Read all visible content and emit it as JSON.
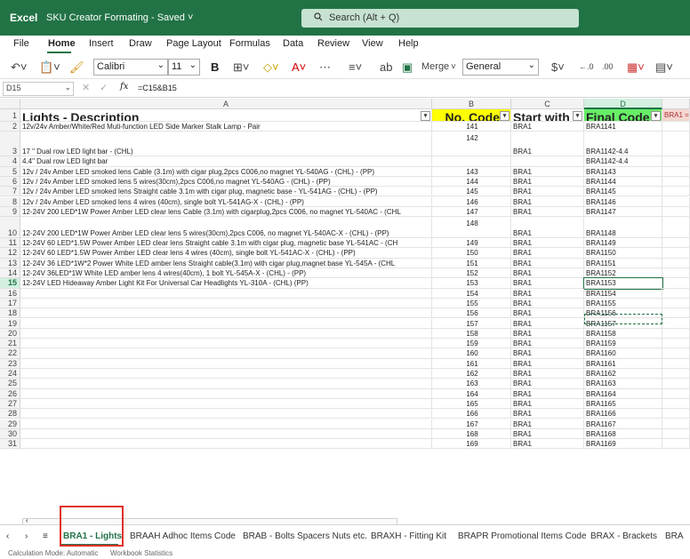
{
  "app": {
    "name": "Excel",
    "doc_title": "SKU Creator Formating",
    "saved_label": "-  Saved",
    "search_placeholder": "Search (Alt + Q)"
  },
  "menu": [
    "File",
    "Home",
    "Insert",
    "Draw",
    "Page Layout",
    "Formulas",
    "Data",
    "Review",
    "View",
    "Help"
  ],
  "ribbon": {
    "font_name": "Calibri",
    "font_size": "11",
    "bold": "B",
    "merge_label": "Merge",
    "number_format": "General",
    "currency_symbol": "$"
  },
  "formula_bar": {
    "cell_ref": "D15",
    "fx": "fx",
    "formula": "=C15&B15"
  },
  "columns": [
    {
      "letter": "A",
      "header": "Lights - Description",
      "selected": false
    },
    {
      "letter": "B",
      "header": "No. Code",
      "selected": false
    },
    {
      "letter": "C",
      "header": "Start with",
      "selected": false
    },
    {
      "letter": "D",
      "header": "Final Code",
      "selected": true
    }
  ],
  "overflow_cell": "BRA1 =",
  "header_colors": {
    "no_code": "#ffff00",
    "final_code": "#66ee66"
  },
  "rows": [
    {
      "n": "2",
      "a": "12v/24v Amber/White/Red Muti-function LED Side Marker Stalk Lamp - Pair",
      "b": "141",
      "c": "BRA1",
      "d": "BRA1141"
    },
    {
      "n": "3",
      "a": "17 \" Dual row LED light bar - (CHL)",
      "b": "142",
      "c": "BRA1",
      "d": "BRA1142-4.4"
    },
    {
      "n": "4",
      "a": "4.4\" Dual row LED light bar",
      "b": "",
      "c": "",
      "d": "BRA1142-4.4"
    },
    {
      "n": "5",
      "a": "12v / 24v  Amber LED smoked lens Cable (3.1m) with cigar plug,2pcs C006,no magnet YL-540AG - (CHL) - (PP)",
      "b": "143",
      "c": "BRA1",
      "d": "BRA1143"
    },
    {
      "n": "6",
      "a": "12v / 24v Amber LED smoked lens 5 wires(30cm),2pcs C006,no magnet YL-540AG - (CHL) - (PP)",
      "b": "144",
      "c": "BRA1",
      "d": "BRA1144"
    },
    {
      "n": "7",
      "a": "12v / 24v  Amber LED smoked lens Straight cable 3.1m with cigar plug, magnetic base - YL-541AG - (CHL)  - (PP)",
      "b": "145",
      "c": "BRA1",
      "d": "BRA1145"
    },
    {
      "n": "8",
      "a": "12v / 24v Amber LED smoked lens 4 wires (40cm), single bolt YL-541AG-X - (CHL) - (PP)",
      "b": "146",
      "c": "BRA1",
      "d": "BRA1146"
    },
    {
      "n": "9",
      "a": "12-24V 200 LED*1W Power Amber LED clear lens Cable (3.1m) with cigarplug,2pcs C006, no magnet YL-540AC - (CHL",
      "b": "147",
      "c": "BRA1",
      "d": "BRA1147"
    },
    {
      "n": "10",
      "a": "12-24V 200 LED*1W Power Amber LED clear lens 5 wires(30cm),2pcs C006, no magnet YL-540AC-X - (CHL) - (PP)",
      "b": "148",
      "c": "BRA1",
      "d": "BRA1148"
    },
    {
      "n": "11",
      "a": "12-24V 60 LED*1.5W Power Amber LED clear lens Straight cable 3.1m with cigar plug, magnetic base YL-541AC - (CH",
      "b": "149",
      "c": "BRA1",
      "d": "BRA1149"
    },
    {
      "n": "12",
      "a": "12-24V 60 LED*1.5W Power Amber LED clear lens 4 wires (40cm), single bolt YL-541AC-X - (CHL) - (PP)",
      "b": "150",
      "c": "BRA1",
      "d": "BRA1150"
    },
    {
      "n": "13",
      "a": "12-24V 36 LED*1W*2 Power White LED amber lens Straight cable(3.1m) with cigar plug,magnet base YL-545A - (CHL",
      "b": "151",
      "c": "BRA1",
      "d": "BRA1151"
    },
    {
      "n": "14",
      "a": "12-24V 36LED*1W White LED amber lens 4 wires(40cm), 1 bolt YL-545A-X - (CHL) - (PP)",
      "b": "152",
      "c": "BRA1",
      "d": "BRA1152"
    },
    {
      "n": "15",
      "a": "12-24V LED Hideaway Amber Light Kit For Universal Car Headlights YL-310A - (CHL) (PP)",
      "b": "153",
      "c": "BRA1",
      "d": "BRA1153"
    },
    {
      "n": "16",
      "a": "",
      "b": "154",
      "c": "BRA1",
      "d": "BRA1154"
    },
    {
      "n": "17",
      "a": "",
      "b": "155",
      "c": "BRA1",
      "d": "BRA1155"
    },
    {
      "n": "18",
      "a": "",
      "b": "156",
      "c": "BRA1",
      "d": "BRA1156"
    },
    {
      "n": "19",
      "a": "",
      "b": "157",
      "c": "BRA1",
      "d": "BRA1157"
    },
    {
      "n": "20",
      "a": "",
      "b": "158",
      "c": "BRA1",
      "d": "BRA1158"
    },
    {
      "n": "21",
      "a": "",
      "b": "159",
      "c": "BRA1",
      "d": "BRA1159"
    },
    {
      "n": "22",
      "a": "",
      "b": "160",
      "c": "BRA1",
      "d": "BRA1160"
    },
    {
      "n": "23",
      "a": "",
      "b": "161",
      "c": "BRA1",
      "d": "BRA1161"
    },
    {
      "n": "24",
      "a": "",
      "b": "162",
      "c": "BRA1",
      "d": "BRA1162"
    },
    {
      "n": "25",
      "a": "",
      "b": "163",
      "c": "BRA1",
      "d": "BRA1163"
    },
    {
      "n": "26",
      "a": "",
      "b": "164",
      "c": "BRA1",
      "d": "BRA1164"
    },
    {
      "n": "27",
      "a": "",
      "b": "165",
      "c": "BRA1",
      "d": "BRA1165"
    },
    {
      "n": "28",
      "a": "",
      "b": "166",
      "c": "BRA1",
      "d": "BRA1166"
    },
    {
      "n": "29",
      "a": "",
      "b": "167",
      "c": "BRA1",
      "d": "BRA1167"
    },
    {
      "n": "30",
      "a": "",
      "b": "168",
      "c": "BRA1",
      "d": "BRA1168"
    },
    {
      "n": "31",
      "a": "",
      "b": "169",
      "c": "BRA1",
      "d": "BRA1169"
    }
  ],
  "sheet_tabs": [
    "BRA1 - Lights",
    "BRAAH Adhoc Items Code",
    "BRAB - Bolts Spacers Nuts etc.",
    "BRAXH - Fitting Kit",
    "BRAPR Promotional Items Code",
    "BRAX - Brackets",
    "BRA"
  ],
  "active_tab": "BRA1 - Lights",
  "status": {
    "calc_mode": "Calculation Mode: Automatic",
    "workbook_stats": "Workbook Statistics"
  }
}
